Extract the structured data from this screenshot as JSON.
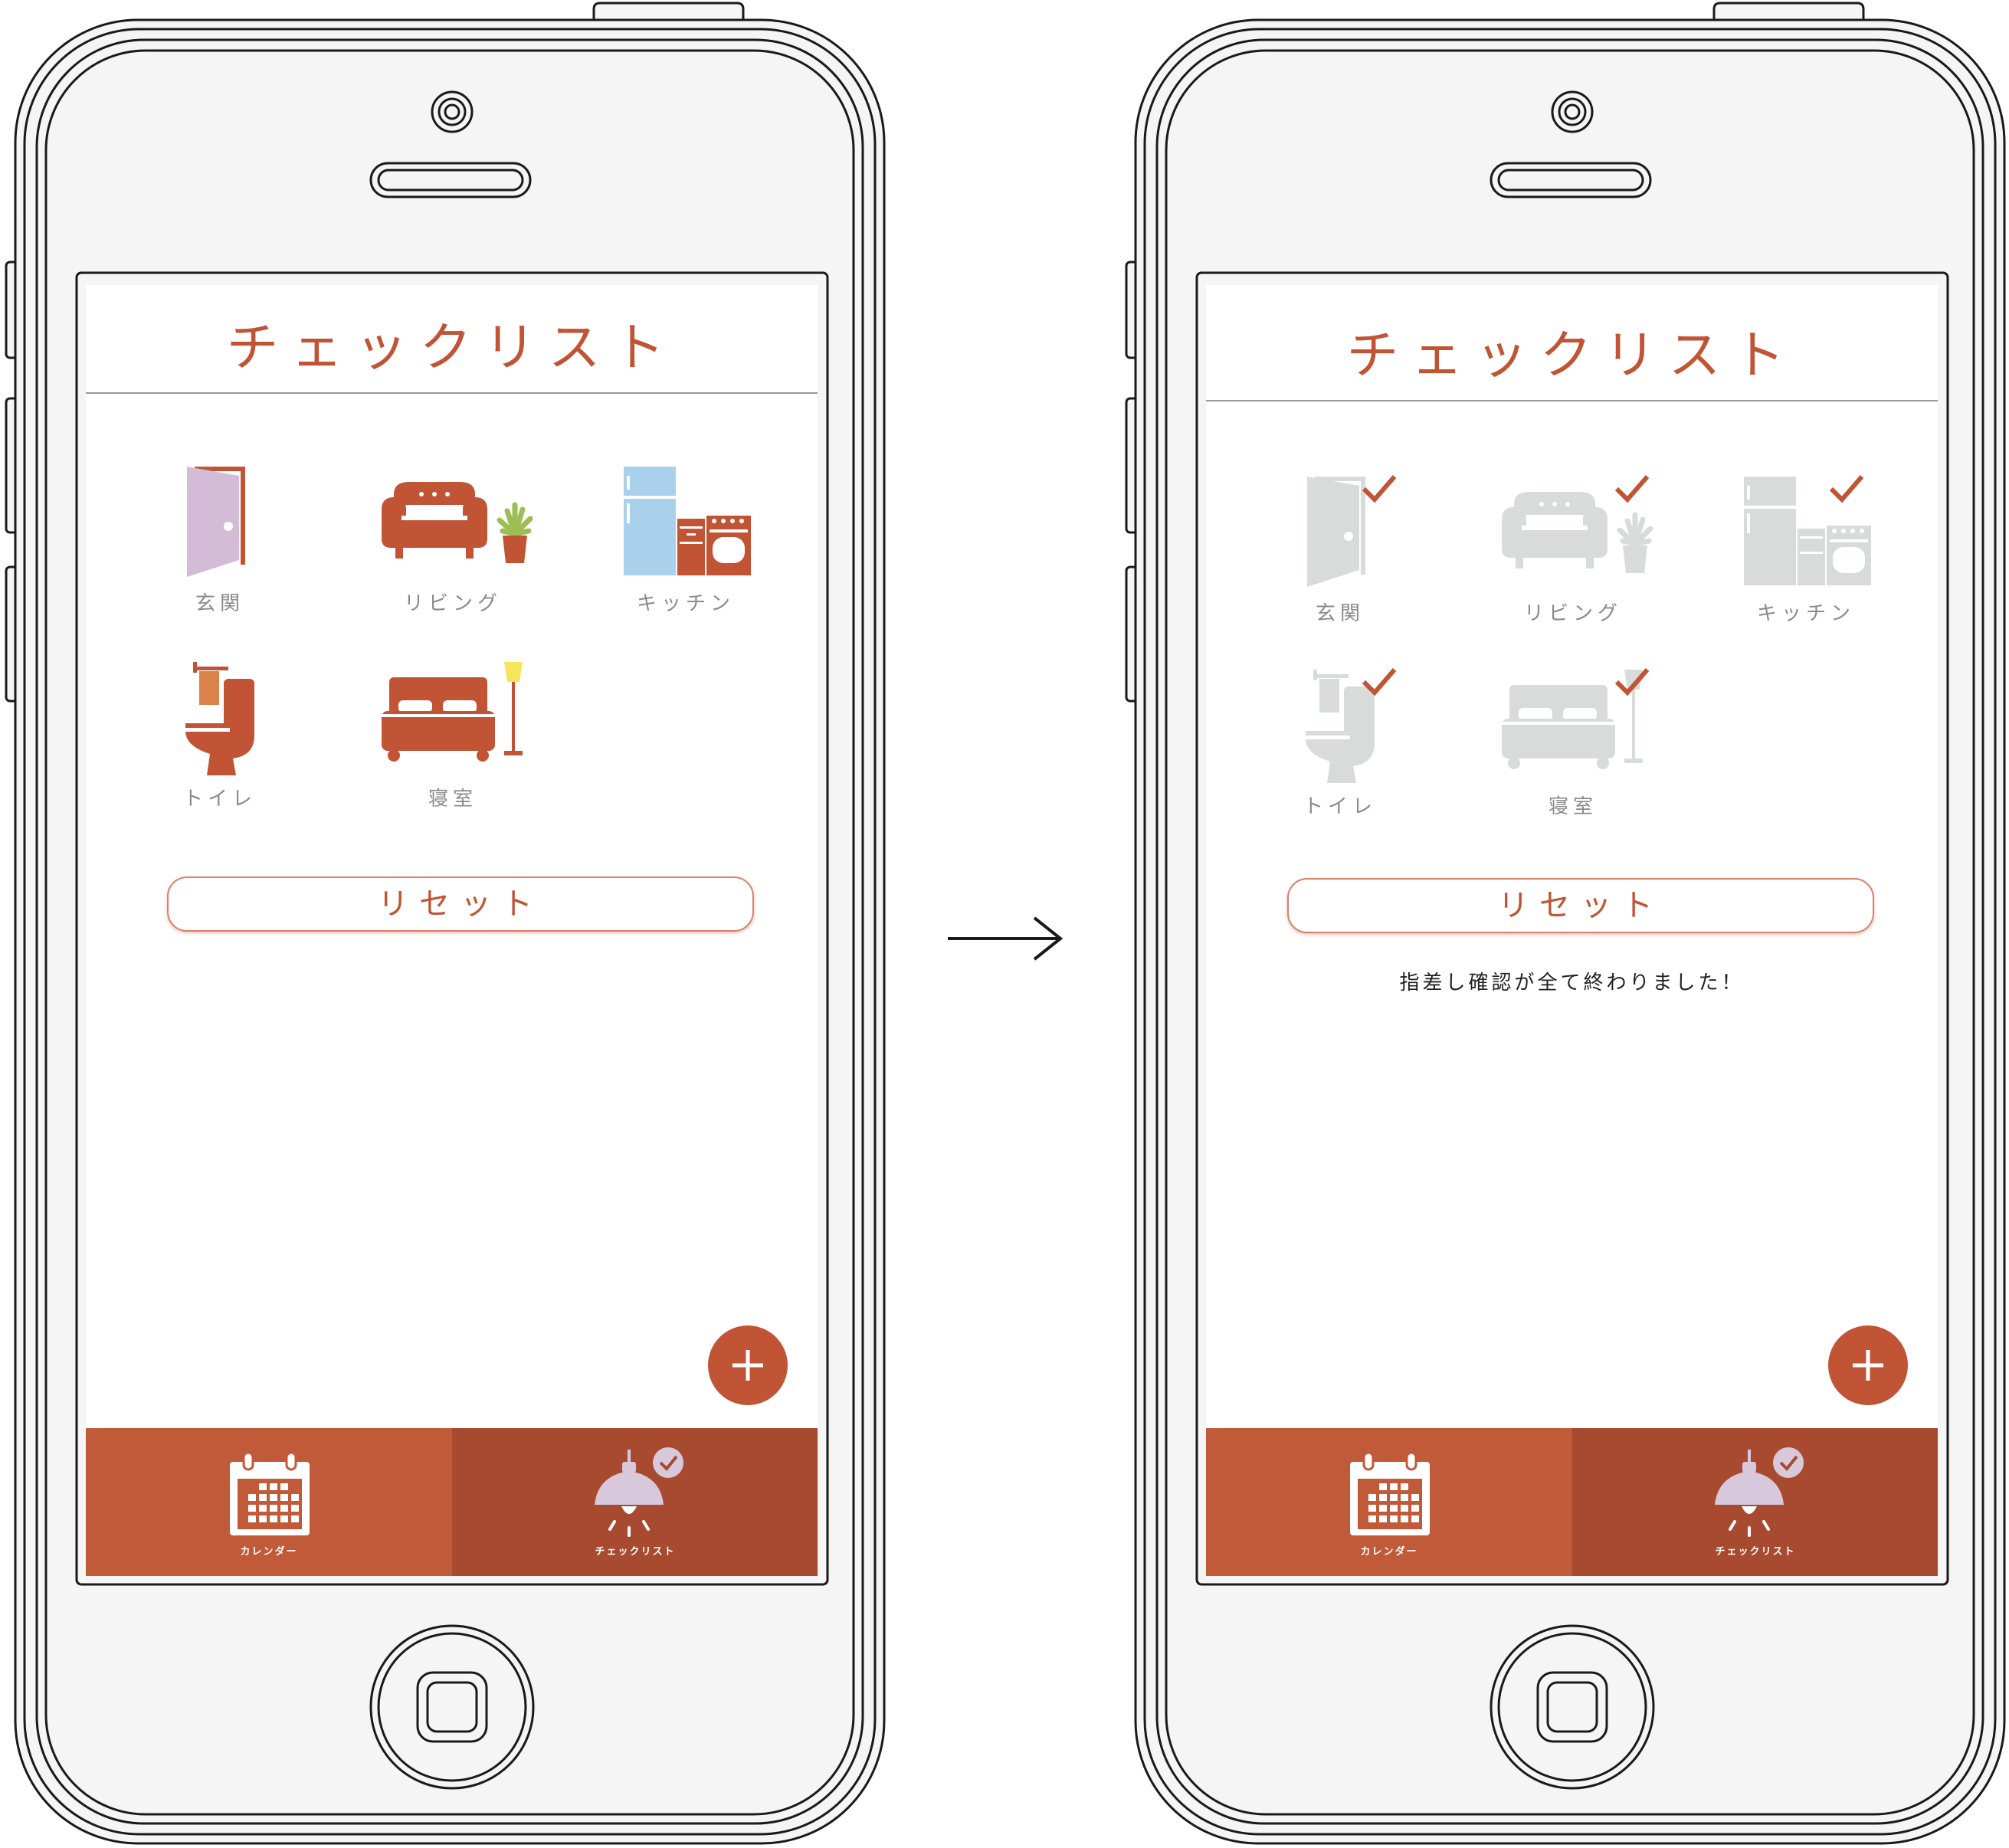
{
  "colors": {
    "accent": "#c05434",
    "tab_calendar": "#c05a38",
    "tab_checklist_active": "#a74a30",
    "checked_icon_gray": "#d9dbda",
    "phone_body": "#f4f5f4"
  },
  "screens": [
    {
      "title": "チェックリスト",
      "rooms": [
        {
          "label": "玄関",
          "icon": "door-icon",
          "checked": false
        },
        {
          "label": "リビング",
          "icon": "sofa-icon",
          "checked": false
        },
        {
          "label": "キッチン",
          "icon": "kitchen-icon",
          "checked": false
        },
        {
          "label": "トイレ",
          "icon": "toilet-icon",
          "checked": false
        },
        {
          "label": "寝室",
          "icon": "bed-icon",
          "checked": false
        }
      ],
      "reset_label": "リセット",
      "completion_message": "",
      "fab_icon": "plus-icon",
      "tabs": [
        {
          "label": "カレンダー",
          "icon": "calendar-icon",
          "active": false
        },
        {
          "label": "チェックリスト",
          "icon": "lamp-icon",
          "active": true
        }
      ]
    },
    {
      "title": "チェックリスト",
      "rooms": [
        {
          "label": "玄関",
          "icon": "door-icon",
          "checked": true
        },
        {
          "label": "リビング",
          "icon": "sofa-icon",
          "checked": true
        },
        {
          "label": "キッチン",
          "icon": "kitchen-icon",
          "checked": true
        },
        {
          "label": "トイレ",
          "icon": "toilet-icon",
          "checked": true
        },
        {
          "label": "寝室",
          "icon": "bed-icon",
          "checked": true
        }
      ],
      "reset_label": "リセット",
      "completion_message": "指差し確認が全て終わりました！",
      "fab_icon": "plus-icon",
      "tabs": [
        {
          "label": "カレンダー",
          "icon": "calendar-icon",
          "active": false
        },
        {
          "label": "チェックリスト",
          "icon": "lamp-icon",
          "active": true
        }
      ]
    }
  ],
  "transition_arrow": "arrow-right-icon"
}
